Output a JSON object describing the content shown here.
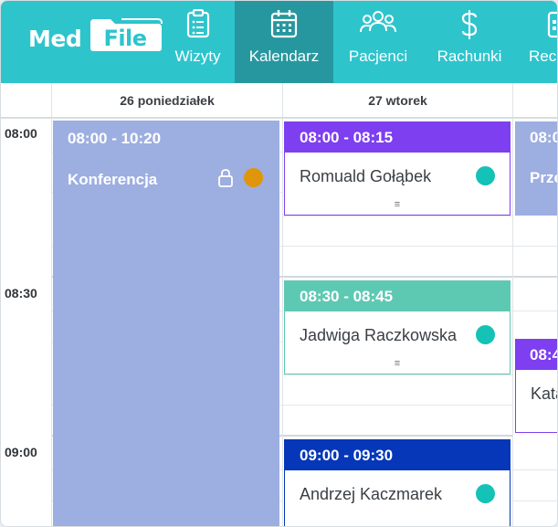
{
  "app": {
    "logo_left": "Med",
    "logo_right": "File"
  },
  "nav": {
    "items": [
      {
        "label": "Wizyty",
        "icon": "clipboard-icon",
        "active": false
      },
      {
        "label": "Kalendarz",
        "icon": "calendar-icon",
        "active": true
      },
      {
        "label": "Pacjenci",
        "icon": "patients-icon",
        "active": false
      },
      {
        "label": "Rachunki",
        "icon": "dollar-icon",
        "active": false
      },
      {
        "label": "Rece",
        "icon": "recepty-icon",
        "active": false
      }
    ]
  },
  "calendar": {
    "days": [
      {
        "label": "26 poniedziałek"
      },
      {
        "label": "27 wtorek"
      }
    ],
    "times": [
      "08:00",
      "08:30",
      "09:00"
    ]
  },
  "events": {
    "conference": {
      "time": "08:00 - 10:20",
      "title": "Konferencja",
      "color": "#9daee0",
      "dot_color": "#e0960b"
    },
    "e1": {
      "time": "08:00 - 08:15",
      "name": "Romuald Gołąbek",
      "color": "#7d3ff0",
      "dot_color": "#14c2b6"
    },
    "e2": {
      "time": "08:30 - 08:45",
      "name": "Jadwiga Raczkowska",
      "color": "#5ec9b3",
      "dot_color": "#14c2b6"
    },
    "e3": {
      "time": "09:00 - 09:30",
      "name": "Andrzej Kaczmarek",
      "color": "#0537b8",
      "dot_color": "#14c2b6"
    },
    "e4": {
      "time": "08:0",
      "name": "Prze",
      "color": "#9daee0"
    },
    "e5": {
      "time": "08:4",
      "name": "Kata",
      "color": "#7d3ff0"
    }
  },
  "colors": {
    "nav_bg": "#2ec4cc",
    "nav_active": "#27979f"
  }
}
